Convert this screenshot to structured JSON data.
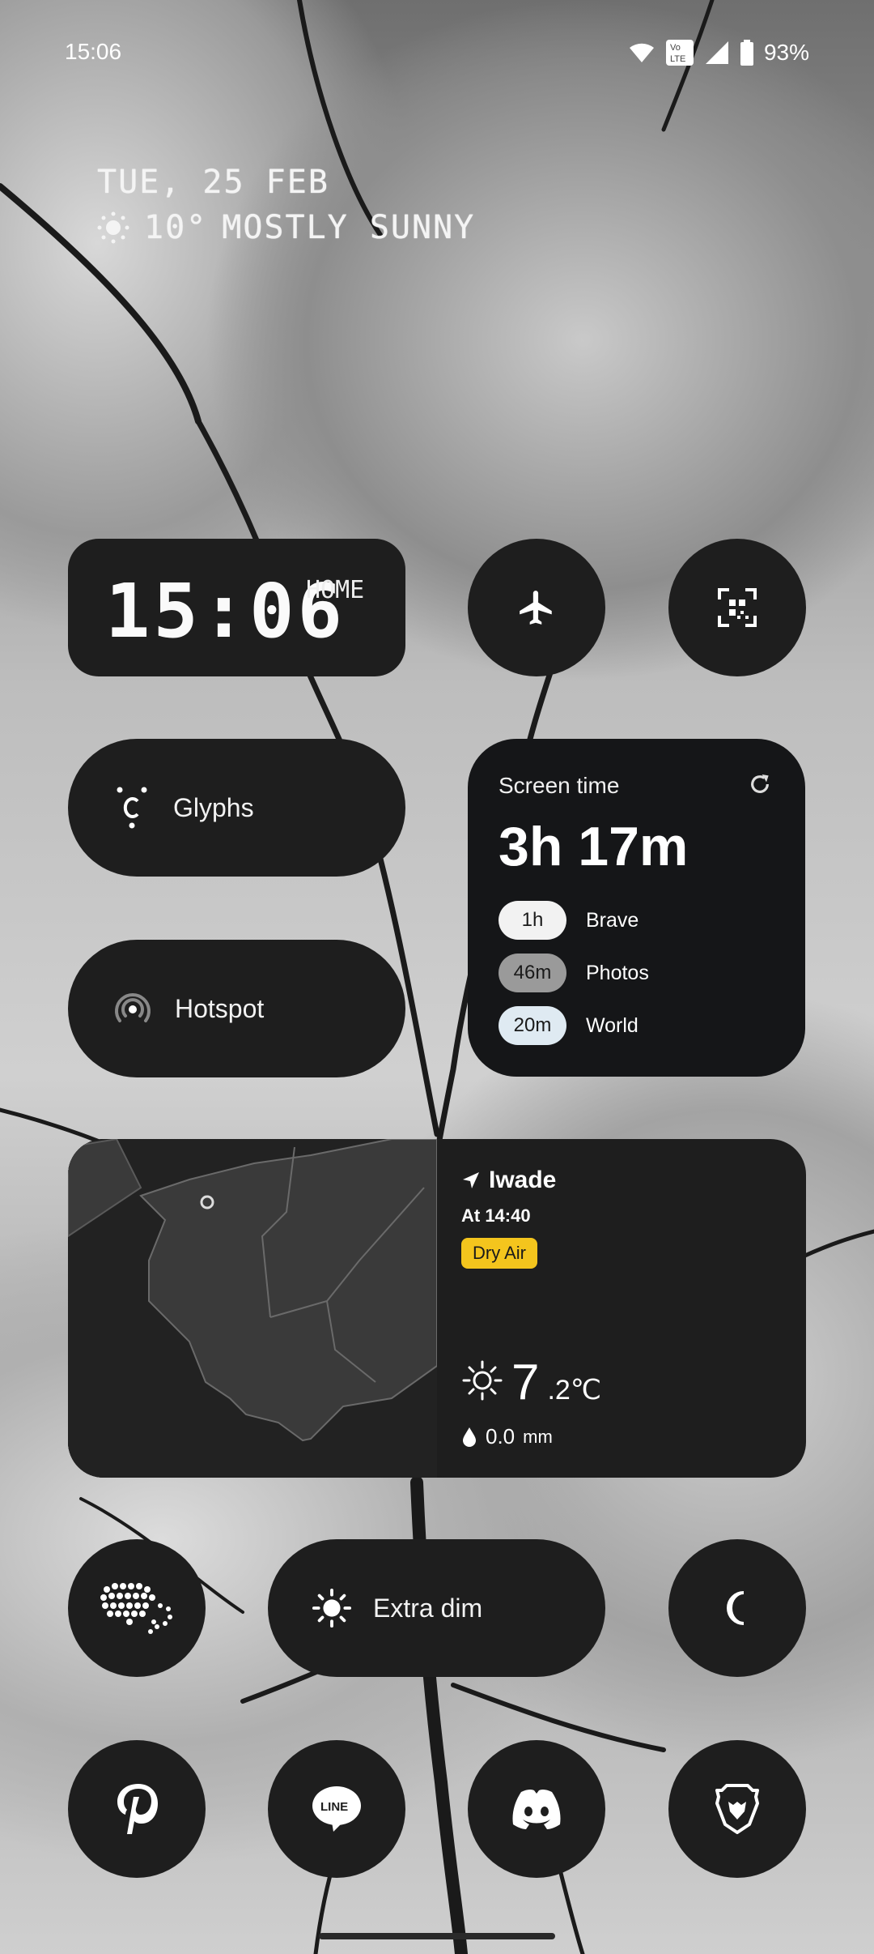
{
  "status_bar": {
    "time": "15:06",
    "battery": "93%"
  },
  "lockscreen": {
    "date": "TUE, 25 FEB",
    "weather_temp": "10°",
    "weather_text": "MOSTLY SUNNY"
  },
  "clock_widget": {
    "time": "15:06",
    "label": "HOME"
  },
  "quick_tiles": {
    "glyphs": "Glyphs",
    "hotspot": "Hotspot",
    "extra_dim": "Extra dim"
  },
  "screen_time": {
    "title": "Screen time",
    "total": "3h 17m",
    "apps": [
      {
        "time": "1h",
        "name": "Brave",
        "color": "#f2f2f2"
      },
      {
        "time": "46m",
        "name": "Photos",
        "color": "#9a9a9a"
      },
      {
        "time": "20m",
        "name": "World",
        "color": "#dfeaf2"
      }
    ]
  },
  "weather_widget": {
    "location": "Iwade",
    "updated": "At 14:40",
    "alert": "Dry Air",
    "temp_whole": "7",
    "temp_decimal": ".2℃",
    "rain_value": "0.0",
    "rain_unit": "mm"
  },
  "colors": {
    "tile": "#1e1e1e",
    "alert": "#f4c51d"
  }
}
